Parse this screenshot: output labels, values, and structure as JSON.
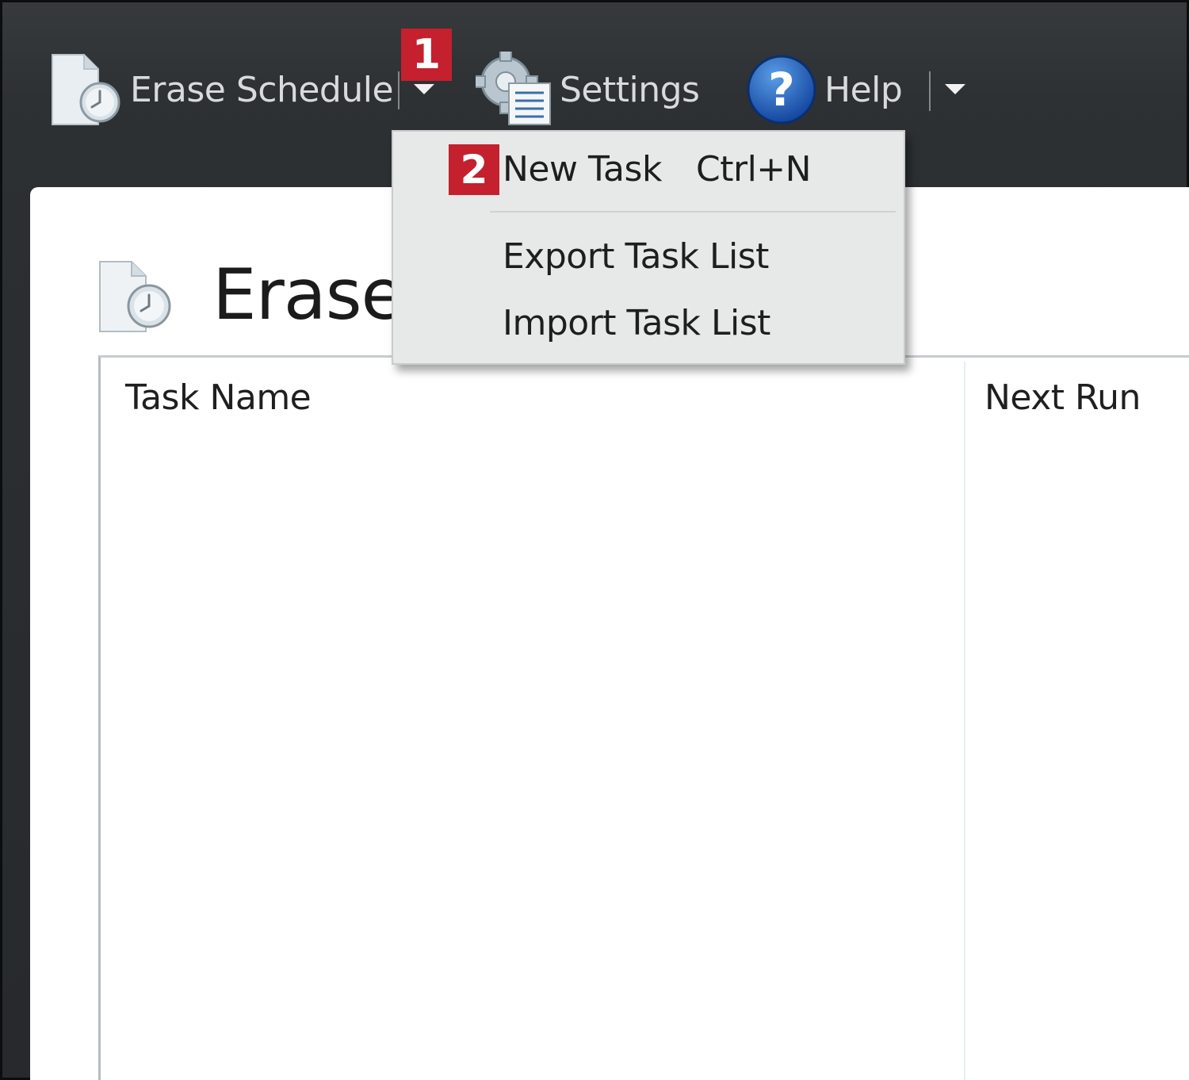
{
  "toolbar": {
    "erase_schedule_label": "Erase Schedule",
    "settings_label": "Settings",
    "help_label": "Help"
  },
  "annotations": {
    "step1": "1",
    "step2": "2"
  },
  "dropdown_menu": {
    "items": [
      {
        "label": "New Task",
        "shortcut": "Ctrl+N"
      },
      {
        "label": "Export Task List"
      },
      {
        "label": "Import Task List"
      }
    ]
  },
  "main": {
    "title": "Erase",
    "columns": [
      "Task Name",
      "Next Run"
    ]
  },
  "colors": {
    "badge": "#c4202e",
    "toolbar_bg": "#2d3133",
    "menu_bg": "#e7e8e8",
    "help_blue": "#1c5bb0"
  },
  "icons": [
    "erase-schedule-icon",
    "dropdown-caret-icon",
    "settings-icon",
    "help-icon",
    "schedule-page-icon"
  ]
}
